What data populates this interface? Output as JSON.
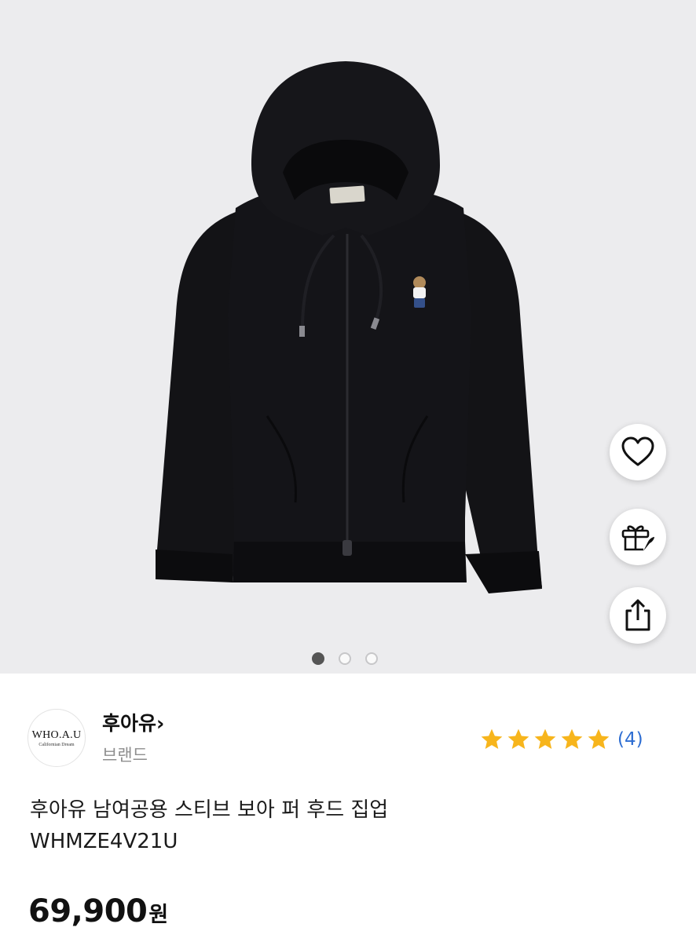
{
  "product_image": {
    "alt": "후아유 남여공용 스티브 보아 퍼 후드 집업"
  },
  "carousel": {
    "count": 3,
    "active_index": 0
  },
  "actions": [
    {
      "name": "wishlist",
      "icon": "heart-icon"
    },
    {
      "name": "gift",
      "icon": "gift-rocket-icon"
    },
    {
      "name": "share",
      "icon": "share-icon"
    }
  ],
  "brand": {
    "logo_main": "WHO.A.U",
    "logo_sub": "Californian Dream",
    "name": "후아유",
    "chevron": "›",
    "type": "브랜드"
  },
  "rating": {
    "stars": 5,
    "count_label": "(4)",
    "star_color": "#f7b51c"
  },
  "product": {
    "title_line1": "후아유 남여공용 스티브 보아 퍼 후드 집업",
    "title_line2": "WHMZE4V21U"
  },
  "price": {
    "amount": "69,900",
    "currency": "원"
  },
  "colors": {
    "accent": "#2d6dd2",
    "star": "#f7b51c",
    "hero_bg": "#ececee"
  }
}
